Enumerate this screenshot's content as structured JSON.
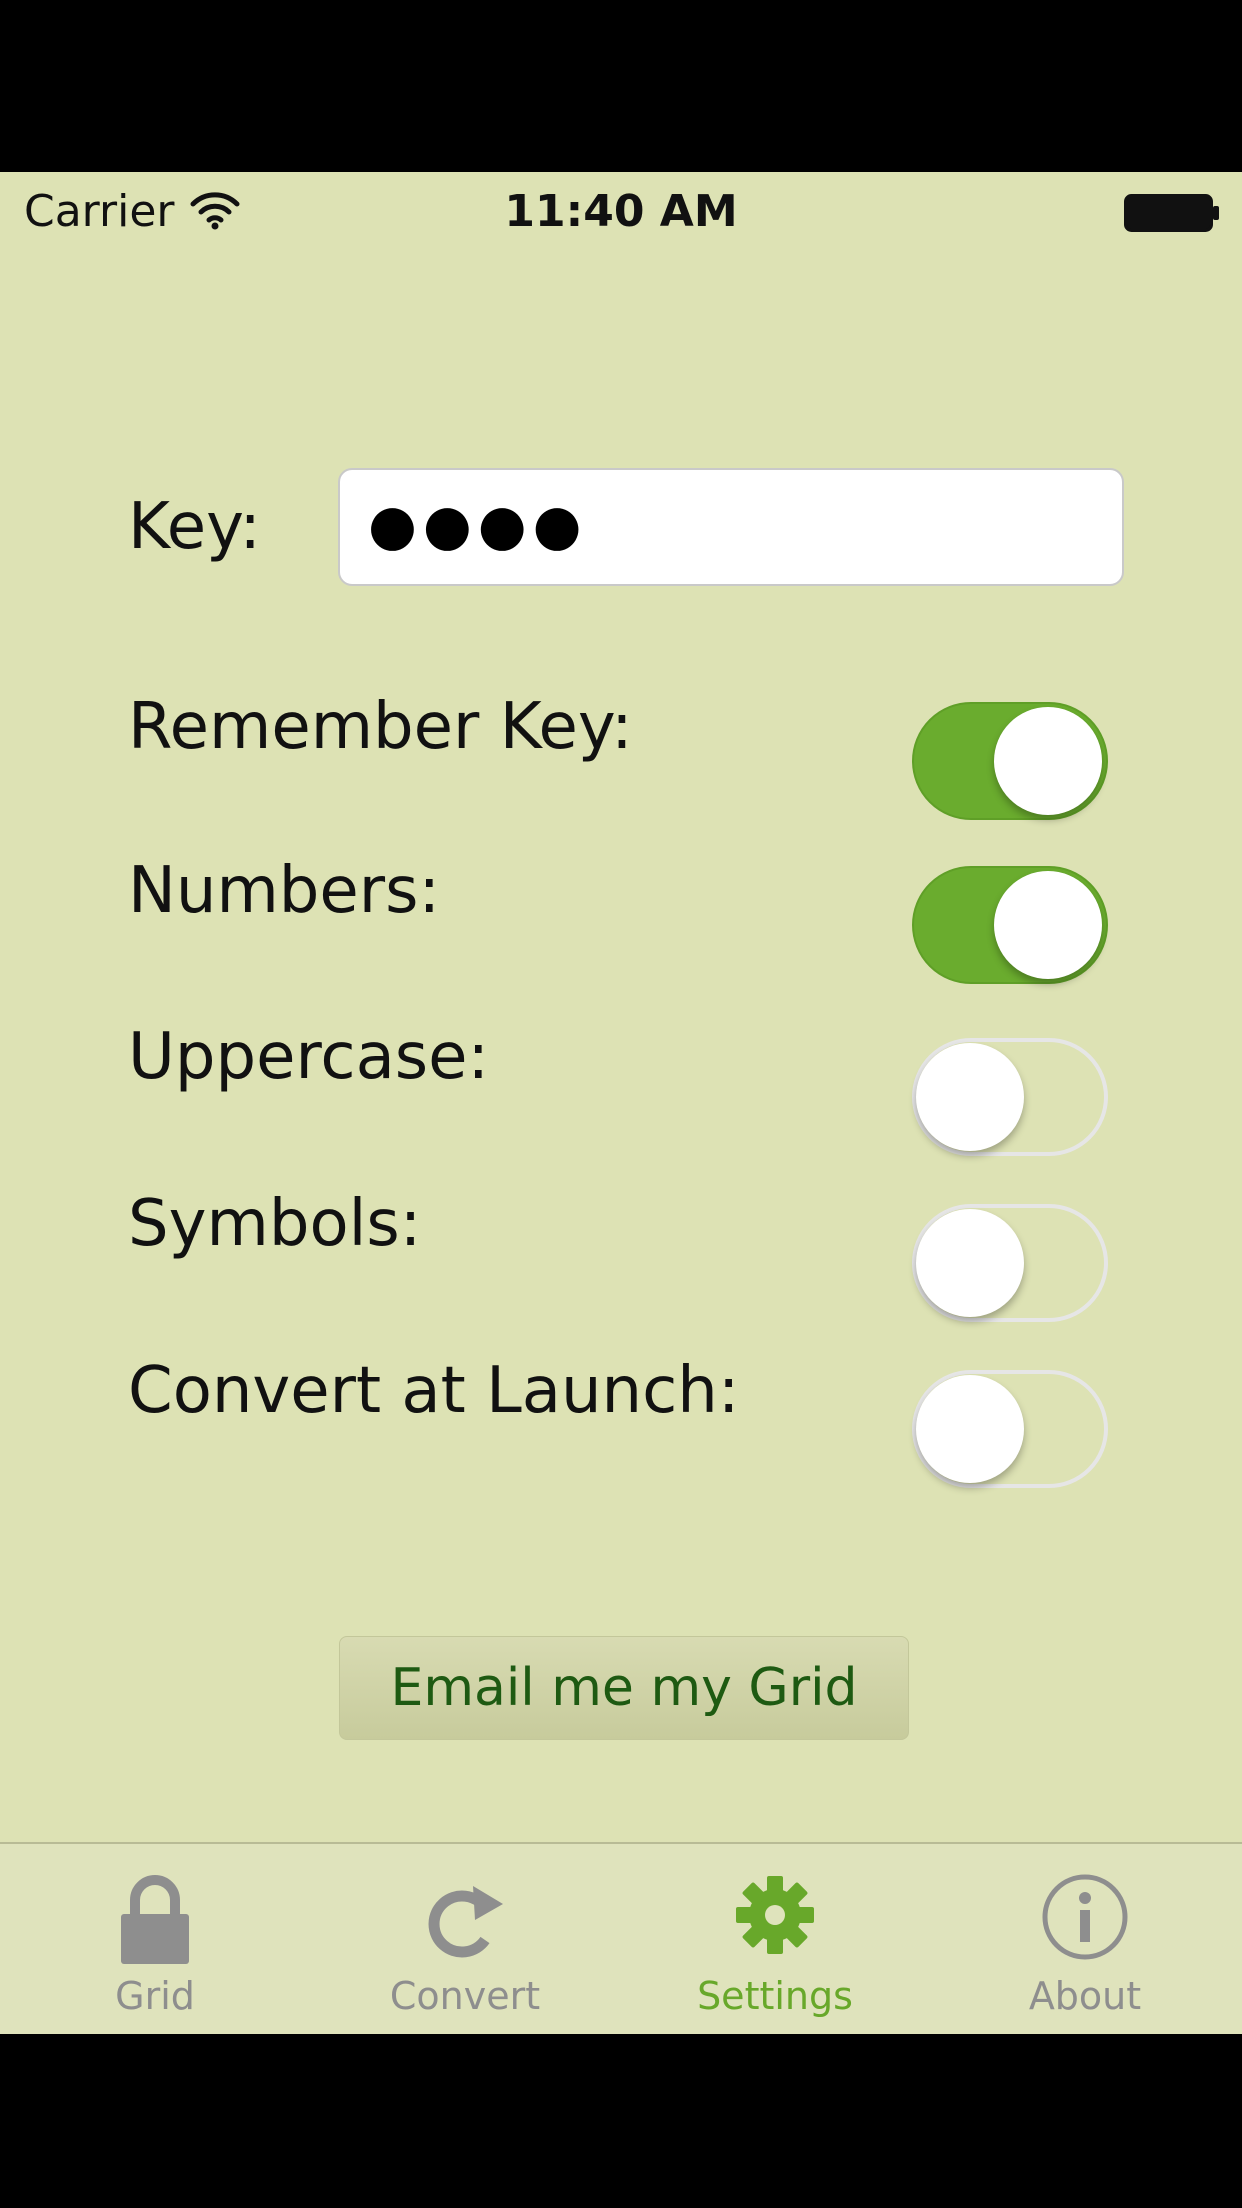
{
  "status_bar": {
    "carrier": "Carrier",
    "time": "11:40 AM"
  },
  "key": {
    "label": "Key:",
    "value": "●●●●"
  },
  "settings": [
    {
      "label": "Remember Key:",
      "on": true
    },
    {
      "label": "Numbers:",
      "on": true
    },
    {
      "label": "Uppercase:",
      "on": false
    },
    {
      "label": "Symbols:",
      "on": false
    },
    {
      "label": "Convert at Launch:",
      "on": false
    }
  ],
  "email_button": "Email me my Grid",
  "tabs": [
    {
      "label": "Grid",
      "icon": "lock-icon",
      "active": false
    },
    {
      "label": "Convert",
      "icon": "redo-icon",
      "active": false
    },
    {
      "label": "Settings",
      "icon": "gear-icon",
      "active": true
    },
    {
      "label": "About",
      "icon": "info-icon",
      "active": false
    }
  ],
  "colors": {
    "background": "#dde2b4",
    "accent": "#68a82a",
    "toggle_on": "#6aac2e",
    "button_text": "#1e5a12",
    "inactive_tab": "#8e8e8e"
  }
}
